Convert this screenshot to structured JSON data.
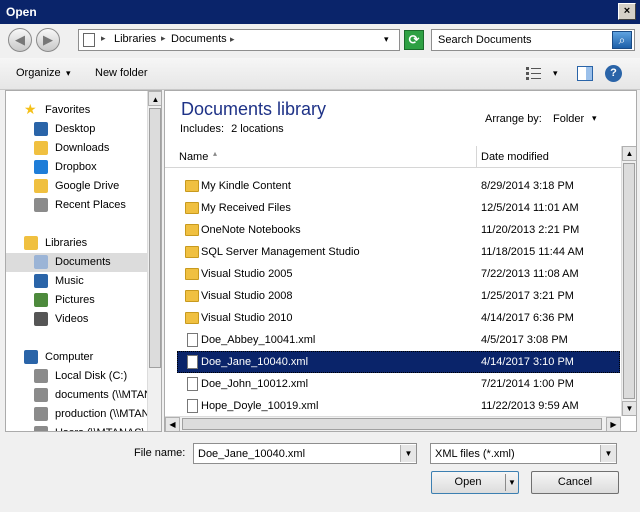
{
  "window": {
    "title": "Open",
    "close_glyph": "×"
  },
  "nav": {
    "back_glyph": "◀",
    "forward_glyph": "▶",
    "breadcrumbs": [
      "Libraries",
      "Documents"
    ],
    "separator": "▸",
    "dropdown_glyph": "▾",
    "refresh_glyph": "⟳",
    "search_placeholder": "Search Documents",
    "search_glyph": "⌕"
  },
  "toolbar": {
    "organize_label": "Organize",
    "new_folder_label": "New folder",
    "arrow_glyph": "▾",
    "help_glyph": "?"
  },
  "sidebar": {
    "items": [
      {
        "label": "Favorites",
        "icon": "star-icon",
        "color": "#f5c018",
        "level": 0
      },
      {
        "label": "Desktop",
        "icon": "desktop-icon",
        "color": "#2a64a8",
        "level": 1
      },
      {
        "label": "Downloads",
        "icon": "downloads-icon",
        "color": "#f0c040",
        "level": 1
      },
      {
        "label": "Dropbox",
        "icon": "dropbox-icon",
        "color": "#1e7dd8",
        "level": 1
      },
      {
        "label": "Google Drive",
        "icon": "google-drive-icon",
        "color": "#f0c040",
        "level": 1
      },
      {
        "label": "Recent Places",
        "icon": "recent-places-icon",
        "color": "#8b8b8b",
        "level": 1
      },
      {
        "label": "Libraries",
        "icon": "libraries-icon",
        "color": "#f0c040",
        "level": 0
      },
      {
        "label": "Documents",
        "icon": "documents-icon",
        "color": "#9bb4d6",
        "level": 1,
        "selected": true
      },
      {
        "label": "Music",
        "icon": "music-icon",
        "color": "#2a64a8",
        "level": 1
      },
      {
        "label": "Pictures",
        "icon": "pictures-icon",
        "color": "#4d8a3c",
        "level": 1
      },
      {
        "label": "Videos",
        "icon": "videos-icon",
        "color": "#555555",
        "level": 1
      },
      {
        "label": "Computer",
        "icon": "computer-icon",
        "color": "#2a64a8",
        "level": 0
      },
      {
        "label": "Local Disk (C:)",
        "icon": "local-disk-icon",
        "color": "#8b8b8b",
        "level": 1
      },
      {
        "label": "documents (\\\\MTAN",
        "icon": "network-drive-icon",
        "color": "#8b8b8b",
        "level": 1
      },
      {
        "label": "production (\\\\MTAN",
        "icon": "network-drive-icon",
        "color": "#8b8b8b",
        "level": 1
      },
      {
        "label": "Users (\\\\MTANAS\\",
        "icon": "network-drive-icon",
        "color": "#8b8b8b",
        "level": 1
      }
    ]
  },
  "library": {
    "title": "Documents library",
    "includes_label": "Includes:",
    "includes_value": "2 locations",
    "arrange_label": "Arrange by:",
    "arrange_value": "Folder"
  },
  "columns": {
    "name": "Name",
    "date": "Date modified",
    "sort_glyph": "▴"
  },
  "files": [
    {
      "name": "My Kindle Content",
      "date": "8/29/2014 3:18 PM",
      "type": "folder"
    },
    {
      "name": "My Received Files",
      "date": "12/5/2014 11:01 AM",
      "type": "folder"
    },
    {
      "name": "OneNote Notebooks",
      "date": "11/20/2013 2:21 PM",
      "type": "folder"
    },
    {
      "name": "SQL Server Management Studio",
      "date": "11/18/2015 11:44 AM",
      "type": "folder"
    },
    {
      "name": "Visual Studio 2005",
      "date": "7/22/2013 11:08 AM",
      "type": "folder"
    },
    {
      "name": "Visual Studio 2008",
      "date": "1/25/2017 3:21 PM",
      "type": "folder"
    },
    {
      "name": "Visual Studio 2010",
      "date": "4/14/2017 6:36 PM",
      "type": "folder"
    },
    {
      "name": "Doe_Abbey_10041.xml",
      "date": "4/5/2017 3:08 PM",
      "type": "file"
    },
    {
      "name": "Doe_Jane_10040.xml",
      "date": "4/14/2017 3:10 PM",
      "type": "file",
      "selected": true
    },
    {
      "name": "Doe_John_10012.xml",
      "date": "7/21/2014 1:00 PM",
      "type": "file"
    },
    {
      "name": "Hope_Doyle_10019.xml",
      "date": "11/22/2013 9:59 AM",
      "type": "file"
    }
  ],
  "scroll": {
    "up": "▲",
    "down": "▼",
    "left": "◀",
    "right": "▶"
  },
  "bottom": {
    "filename_label": "File name:",
    "filename_value": "Doe_Jane_10040.xml",
    "filetype_value": "XML files (*.xml)",
    "drop_glyph": "▼",
    "open_label": "Open",
    "cancel_label": "Cancel"
  }
}
